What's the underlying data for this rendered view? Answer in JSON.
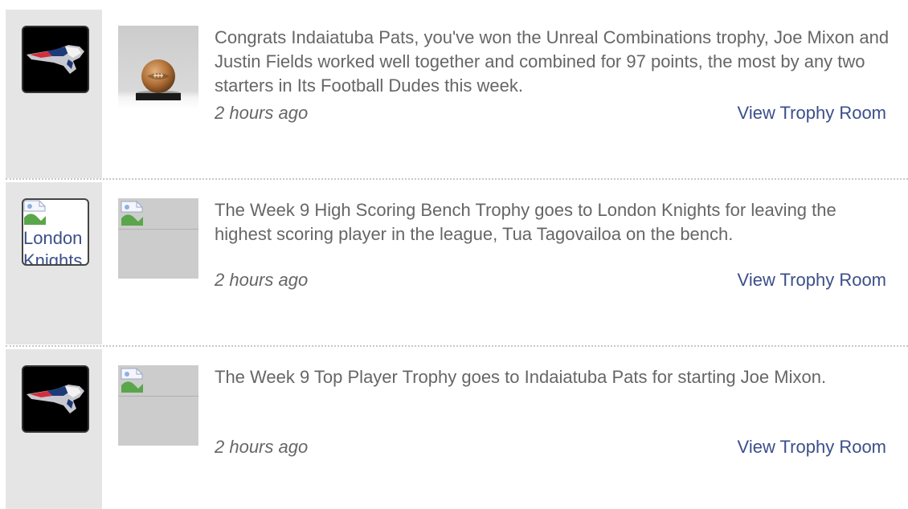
{
  "feed": {
    "items": [
      {
        "team": "Indaiatuba Pats",
        "avatar_icon": "patriots-logo-icon",
        "trophy_icon": "football-trophy-icon",
        "message": "Congrats Indaiatuba Pats, you've won the Unreal Combinations trophy, Joe Mixon and Justin Fields worked well together and combined for 97 points, the most by any two starters in Its Football Dudes this week.",
        "time": "2 hours ago",
        "link": "View Trophy Room"
      },
      {
        "team": "London Knights",
        "avatar_alt": "London Knights",
        "avatar_icon": "broken-image-icon",
        "trophy_icon": "broken-image-icon",
        "message": "The Week 9 High Scoring Bench Trophy goes to London Knights for leaving the highest scoring player in the league, Tua Tagovailoa on the bench.",
        "time": "2 hours ago",
        "link": "View Trophy Room"
      },
      {
        "team": "Indaiatuba Pats",
        "avatar_icon": "patriots-logo-icon",
        "trophy_icon": "broken-image-icon",
        "message": "The Week 9 Top Player Trophy goes to Indaiatuba Pats for starting Joe Mixon.",
        "time": "2 hours ago",
        "link": "View Trophy Room"
      }
    ]
  },
  "colors": {
    "gutter": "#e5e5e5",
    "text": "#666666",
    "link": "#3b4f8a",
    "placeholder": "#cccccc"
  }
}
